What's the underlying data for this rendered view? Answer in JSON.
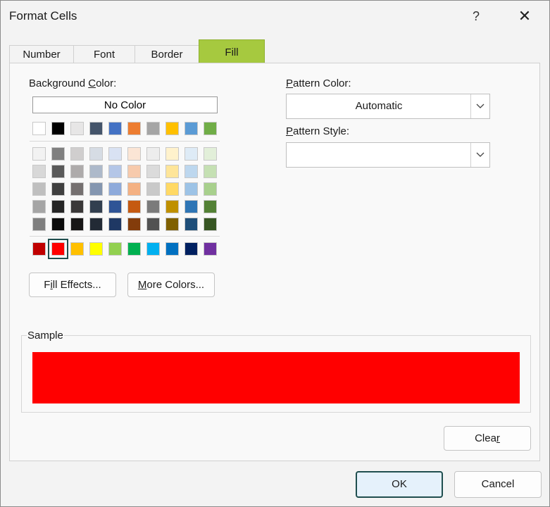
{
  "window": {
    "title": "Format Cells",
    "help_glyph": "?",
    "close_glyph": "✕"
  },
  "tabs": [
    {
      "label": "Number",
      "active": false
    },
    {
      "label": "Font",
      "active": false
    },
    {
      "label": "Border",
      "active": false
    },
    {
      "label": "Fill",
      "active": true
    }
  ],
  "background_color": {
    "label_pre": "Background ",
    "label_u": "C",
    "label_post": "olor:",
    "no_color_label": "No Color",
    "selected": "#ff0000",
    "theme_top_row": [
      "#ffffff",
      "#000000",
      "#e7e6e6",
      "#44546a",
      "#4472c4",
      "#ed7d31",
      "#a5a5a5",
      "#ffc000",
      "#5b9bd5",
      "#70ad47"
    ],
    "theme_shades": [
      [
        "#f2f2f2",
        "#7f7f7f",
        "#d0cece",
        "#d6dce4",
        "#d9e2f3",
        "#fbe5d5",
        "#ededed",
        "#fff2cc",
        "#deebf6",
        "#e2efd9"
      ],
      [
        "#d8d8d8",
        "#595959",
        "#aeabab",
        "#adb9ca",
        "#b4c6e7",
        "#f7caac",
        "#dbdbdb",
        "#fee599",
        "#bdd7ee",
        "#c5e0b3"
      ],
      [
        "#bfbfbf",
        "#3f3f3f",
        "#757070",
        "#8496b0",
        "#8eaadb",
        "#f4b183",
        "#c9c9c9",
        "#ffd965",
        "#9dc3e6",
        "#a8d08d"
      ],
      [
        "#a5a5a5",
        "#262626",
        "#3a3838",
        "#323f4f",
        "#2f5496",
        "#c55a11",
        "#7b7b7b",
        "#bf9000",
        "#2e75b5",
        "#538135"
      ],
      [
        "#7f7f7f",
        "#0c0c0c",
        "#171616",
        "#222a35",
        "#1f3864",
        "#833c0b",
        "#525252",
        "#7f6000",
        "#1e4e79",
        "#375623"
      ]
    ],
    "standard_colors": [
      "#c00000",
      "#ff0000",
      "#ffc000",
      "#ffff00",
      "#92d050",
      "#00b050",
      "#00b0f0",
      "#0070c0",
      "#002060",
      "#7030a0"
    ]
  },
  "buttons": {
    "fill_effects_u": "i",
    "fill_effects_pre": "F",
    "fill_effects_post": "ll Effects...",
    "more_colors_u": "M",
    "more_colors_post": "ore Colors..."
  },
  "pattern_color": {
    "label_u": "P",
    "label_rest": "attern Color:",
    "value": "Automatic"
  },
  "pattern_style": {
    "label_u": "P",
    "label_rest": "attern Style:",
    "value": ""
  },
  "sample": {
    "label": "Sample",
    "color": "#ff0000"
  },
  "clear_button": {
    "pre": "Clea",
    "u": "r",
    "post": ""
  },
  "footer": {
    "ok": "OK",
    "cancel": "Cancel"
  }
}
